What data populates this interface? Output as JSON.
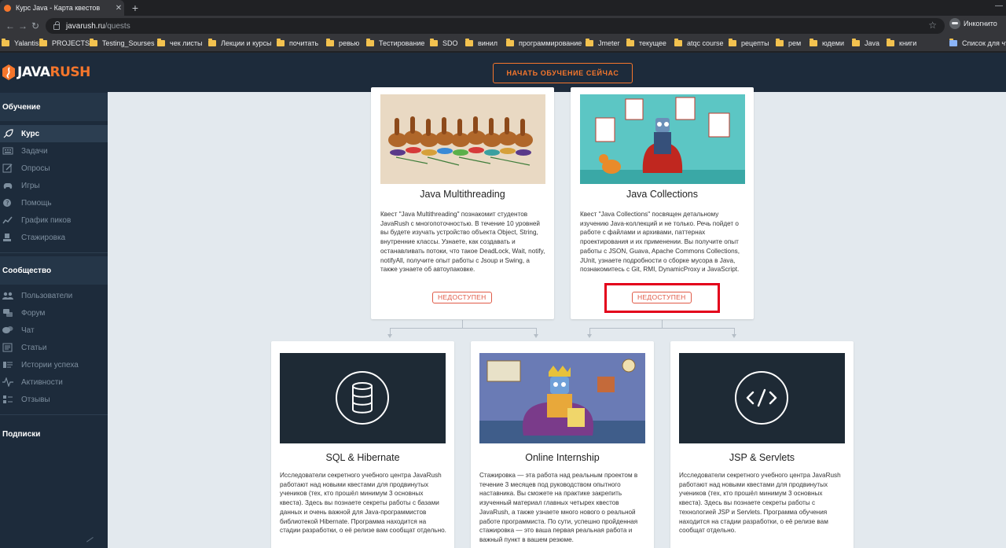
{
  "browser": {
    "tab_title": "Курс Java - Карта квестов",
    "tab_close": "✕",
    "new_tab": "+",
    "url_host": "javarush.ru",
    "url_path": "/quests",
    "incognito_label": "Инкогнито",
    "bookmarks": [
      "Yalantis",
      "PROJECTS",
      "Testing_Sourses",
      "чек листы",
      "Лекции и курсы",
      "почитать",
      "ревью",
      "Тестирование",
      "SDO",
      "винил",
      "программирование",
      "Jmeter",
      "текущее",
      "atqc course",
      "рецепты",
      "рем",
      "юдеми",
      "Java",
      "книги",
      "Список для чтения"
    ]
  },
  "logo": {
    "part1": "JAVA",
    "part2": "RUSH"
  },
  "topbar": {
    "cta": "НАЧАТЬ ОБУЧЕНИЕ СЕЙЧАС"
  },
  "sidebar": {
    "learning": {
      "title": "Обучение",
      "items": [
        {
          "label": "Курс",
          "icon": "rocket-icon"
        },
        {
          "label": "Задачи",
          "icon": "keyboard-icon"
        },
        {
          "label": "Опросы",
          "icon": "edit-icon"
        },
        {
          "label": "Игры",
          "icon": "gamepad-icon"
        },
        {
          "label": "Помощь",
          "icon": "help-icon"
        },
        {
          "label": "График пиков",
          "icon": "chart-icon"
        },
        {
          "label": "Стажировка",
          "icon": "person-icon"
        }
      ]
    },
    "community": {
      "title": "Сообщество",
      "items": [
        {
          "label": "Пользователи",
          "icon": "users-icon"
        },
        {
          "label": "Форум",
          "icon": "forum-icon"
        },
        {
          "label": "Чат",
          "icon": "chat-icon"
        },
        {
          "label": "Статьи",
          "icon": "article-icon"
        },
        {
          "label": "Истории успеха",
          "icon": "story-icon"
        },
        {
          "label": "Активности",
          "icon": "activity-icon"
        },
        {
          "label": "Отзывы",
          "icon": "review-icon"
        }
      ]
    },
    "subscriptions": {
      "title": "Подписки"
    }
  },
  "cards": {
    "multithreading": {
      "title": "Java Multithreading",
      "desc": "Квест \"Java Multithreading\" познакомит студентов JavaRush с многопоточностью. В течение 10 уровней вы будете изучать устройство объекта Object, String, внутренние классы. Узнаете, как создавать и останавливать потоки, что такое DeadLock, Wait, notify, notifyAll, получите опыт работы с Jsoup и Swing, а также узнаете об автоупаковке.",
      "badge": "НЕДОСТУПЕН"
    },
    "collections": {
      "title": "Java Collections",
      "desc": "Квест \"Java Collections\" посвящен детальному изучению Java-коллекций и не только. Речь пойдет о работе с файлами и архивами, паттернах проектирования и их применении. Вы получите опыт работы с JSON, Guava, Apache Commons Collections, JUnit, узнаете подробности о сборке мусора в Java, познакомитесь с Git, RMI, DynamicProxy и JavaScript.",
      "badge": "НЕДОСТУПЕН"
    },
    "sql": {
      "title": "SQL & Hibernate",
      "desc": "Исследователи секретного учебного центра JavaRush работают над новыми квестами для продвинутых учеников (тех, кто прошёл минимум 3 основных квеста). Здесь вы познаете секреты работы с базами данных и очень важной для Java-программистов библиотекой Hibernate. Программа находится на стадии разработки, о её релизе вам сообщат отдельно."
    },
    "internship": {
      "title": "Online Internship",
      "desc": "Стажировка — эта работа над реальным проектом в течение 3 месяцев под руководством опытного наставника. Вы сможете на практике закрепить изученный материал главных четырех квестов JavaRush, а также узнаете много нового о реальной работе программиста. По сути, успешно пройденная стажировка — это ваша первая реальная работа и важный пункт в вашем резюме."
    },
    "jsp": {
      "title": "JSP & Servlets",
      "desc": "Исследователи секретного учебного центра JavaRush работают над новыми квестами для продвинутых учеников (тех, кто прошёл минимум 3 основных квеста). Здесь вы познаете секреты работы с технологией JSP и Servlets. Программа обучения находится на стадии разработки, о её релизе вам сообщат отдельно."
    }
  },
  "colors": {
    "brand": "#f5762c",
    "sidebar": "#1d2b3b",
    "badge": "#e05a47",
    "highlight": "#e3001b"
  }
}
